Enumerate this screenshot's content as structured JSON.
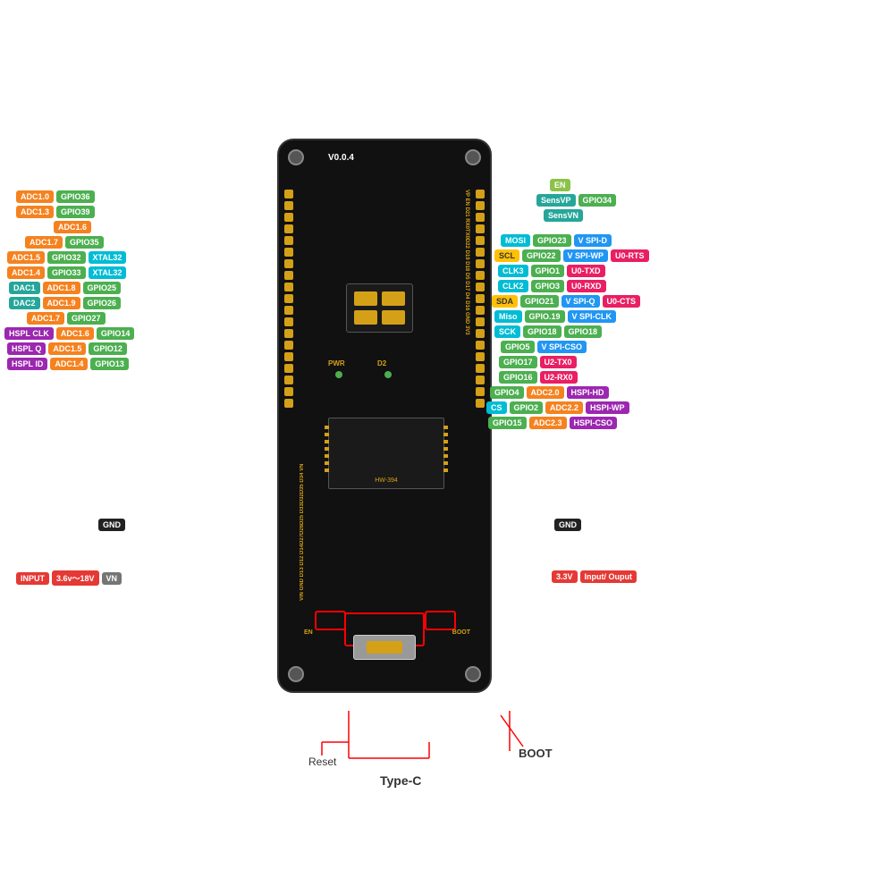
{
  "board": {
    "version": "V0.0.4",
    "model": "HW-394",
    "background": "#111111"
  },
  "annotations": {
    "reset_label": "Reset",
    "boot_label": "BOOT",
    "typec_label": "Type-C"
  },
  "left_pins": [
    {
      "row": 1,
      "tags": [
        {
          "label": "ADC1.0",
          "color": "orange"
        },
        {
          "label": "GPIO36",
          "color": "green"
        }
      ]
    },
    {
      "row": 2,
      "tags": [
        {
          "label": "ADC1.3",
          "color": "orange"
        },
        {
          "label": "GPIO39",
          "color": "green"
        }
      ]
    },
    {
      "row": 3,
      "tags": [
        {
          "label": "ADC1.6",
          "color": "orange"
        }
      ]
    },
    {
      "row": 4,
      "tags": [
        {
          "label": "ADC1.7",
          "color": "orange"
        },
        {
          "label": "GPIO35",
          "color": "green"
        }
      ]
    },
    {
      "row": 5,
      "tags": [
        {
          "label": "ADC1.5",
          "color": "orange"
        },
        {
          "label": "GPIO32",
          "color": "green"
        },
        {
          "label": "XTAL32",
          "color": "cyan"
        }
      ]
    },
    {
      "row": 6,
      "tags": [
        {
          "label": "ADC1.4",
          "color": "orange"
        },
        {
          "label": "GPIO33",
          "color": "green"
        },
        {
          "label": "XTAL32",
          "color": "cyan"
        }
      ]
    },
    {
      "row": 7,
      "tags": [
        {
          "label": "DAC1",
          "color": "teal"
        },
        {
          "label": "ADC1.8",
          "color": "orange"
        },
        {
          "label": "GPIO25",
          "color": "green"
        }
      ]
    },
    {
      "row": 8,
      "tags": [
        {
          "label": "DAC2",
          "color": "teal"
        },
        {
          "label": "ADC1.9",
          "color": "orange"
        },
        {
          "label": "GPIO26",
          "color": "green"
        }
      ]
    },
    {
      "row": 9,
      "tags": [
        {
          "label": "ADC1.7",
          "color": "orange"
        },
        {
          "label": "GPIO27",
          "color": "green"
        }
      ]
    },
    {
      "row": 10,
      "tags": [
        {
          "label": "HSPL CLK",
          "color": "purple"
        },
        {
          "label": "ADC1.6",
          "color": "orange"
        },
        {
          "label": "GPIO14",
          "color": "green"
        }
      ]
    },
    {
      "row": 11,
      "tags": [
        {
          "label": "HSPL Q",
          "color": "purple"
        },
        {
          "label": "ADC1.5",
          "color": "orange"
        },
        {
          "label": "GPIO12",
          "color": "green"
        }
      ]
    },
    {
      "row": 12,
      "tags": [
        {
          "label": "HSPL ID",
          "color": "purple"
        },
        {
          "label": "ADC1.4",
          "color": "orange"
        },
        {
          "label": "GPIO13",
          "color": "green"
        }
      ]
    },
    {
      "row": 13,
      "tags": [
        {
          "label": "GND",
          "color": "black-tag"
        }
      ]
    },
    {
      "row": 14,
      "tags": [
        {
          "label": "INPUT",
          "color": "red"
        },
        {
          "label": "3.6v~18V",
          "color": "red"
        },
        {
          "label": "VN",
          "color": "gray"
        }
      ]
    }
  ],
  "right_pins": [
    {
      "row": 1,
      "tags": [
        {
          "label": "EN",
          "color": "lime"
        }
      ]
    },
    {
      "row": 2,
      "tags": [
        {
          "label": "SensVP",
          "color": "teal"
        },
        {
          "label": "GPIO34",
          "color": "green"
        }
      ]
    },
    {
      "row": 3,
      "tags": [
        {
          "label": "SensVN",
          "color": "teal"
        }
      ]
    },
    {
      "row": 4,
      "tags": []
    },
    {
      "row": 5,
      "tags": [
        {
          "label": "MOSI",
          "color": "cyan"
        },
        {
          "label": "GPIO23",
          "color": "green"
        },
        {
          "label": "V SPI-D",
          "color": "blue"
        }
      ]
    },
    {
      "row": 6,
      "tags": [
        {
          "label": "SCL",
          "color": "amber"
        },
        {
          "label": "GPIO22",
          "color": "green"
        },
        {
          "label": "V SPI-WP",
          "color": "blue"
        },
        {
          "label": "U0-RTS",
          "color": "pink"
        }
      ]
    },
    {
      "row": 7,
      "tags": [
        {
          "label": "CLK3",
          "color": "cyan"
        },
        {
          "label": "GPIO1",
          "color": "green"
        },
        {
          "label": "U0-TXD",
          "color": "pink"
        }
      ]
    },
    {
      "row": 8,
      "tags": [
        {
          "label": "CLK2",
          "color": "cyan"
        },
        {
          "label": "GPIO3",
          "color": "green"
        },
        {
          "label": "U0-RXD",
          "color": "pink"
        }
      ]
    },
    {
      "row": 9,
      "tags": [
        {
          "label": "SDA",
          "color": "amber"
        },
        {
          "label": "GPIO21",
          "color": "green"
        },
        {
          "label": "V SPI-Q",
          "color": "blue"
        },
        {
          "label": "U0-CTS",
          "color": "pink"
        }
      ]
    },
    {
      "row": 10,
      "tags": [
        {
          "label": "MISO",
          "color": "cyan"
        },
        {
          "label": "GPIO19",
          "color": "green"
        },
        {
          "label": "V SPI-CLK",
          "color": "blue"
        }
      ]
    },
    {
      "row": 11,
      "tags": [
        {
          "label": "SCK",
          "color": "cyan"
        },
        {
          "label": "GPIO18",
          "color": "green"
        },
        {
          "label": "GPIO18",
          "color": "green"
        }
      ]
    },
    {
      "row": 12,
      "tags": [
        {
          "label": "GPIO5",
          "color": "green"
        },
        {
          "label": "V SPI-CSO",
          "color": "blue"
        }
      ]
    },
    {
      "row": 13,
      "tags": [
        {
          "label": "GPIO17",
          "color": "green"
        },
        {
          "label": "U2-TX0",
          "color": "pink"
        }
      ]
    },
    {
      "row": 14,
      "tags": [
        {
          "label": "GPIO16",
          "color": "green"
        },
        {
          "label": "U2-RX0",
          "color": "pink"
        }
      ]
    },
    {
      "row": 15,
      "tags": [
        {
          "label": "GPIO4",
          "color": "green"
        },
        {
          "label": "ADC2.0",
          "color": "orange"
        },
        {
          "label": "HSPI-HD",
          "color": "purple"
        }
      ]
    },
    {
      "row": 16,
      "tags": [
        {
          "label": "CS",
          "color": "cyan"
        },
        {
          "label": "GPIO2",
          "color": "green"
        },
        {
          "label": "ADC2.2",
          "color": "orange"
        },
        {
          "label": "HSPI-WP",
          "color": "purple"
        }
      ]
    },
    {
      "row": 17,
      "tags": [
        {
          "label": "GPIO15",
          "color": "green"
        },
        {
          "label": "ADC2.3",
          "color": "orange"
        },
        {
          "label": "HSPI-CSO",
          "color": "purple"
        }
      ]
    },
    {
      "row": 18,
      "tags": [
        {
          "label": "GND",
          "color": "black-tag"
        }
      ]
    },
    {
      "row": 19,
      "tags": [
        {
          "label": "3.3V",
          "color": "red"
        },
        {
          "label": "Input/ Ouput",
          "color": "red"
        }
      ]
    }
  ]
}
